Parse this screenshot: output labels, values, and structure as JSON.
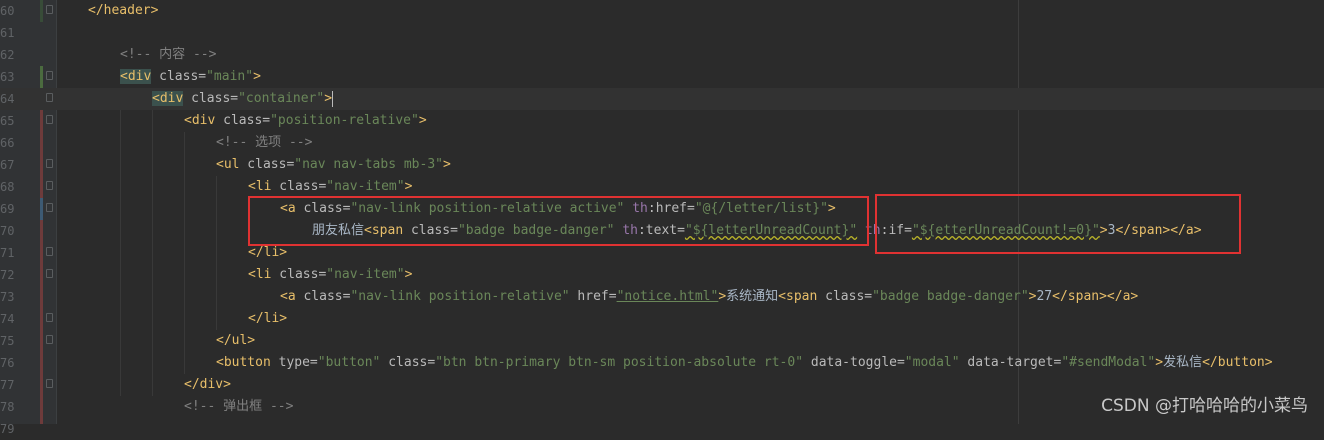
{
  "editor": {
    "lines": [
      {
        "num": "60",
        "parts": [
          {
            "t": "</header>",
            "c": "tag"
          }
        ]
      },
      {
        "num": "61",
        "parts": []
      },
      {
        "num": "62",
        "parts": [
          {
            "t": "<!-- 内容 -->",
            "c": "comment"
          }
        ]
      },
      {
        "num": "63",
        "parts": [
          {
            "t": "<div",
            "c": "tag matched"
          },
          {
            "t": " class=",
            "c": "attr"
          },
          {
            "t": "\"main\"",
            "c": "str"
          },
          {
            "t": ">",
            "c": "tag"
          }
        ]
      },
      {
        "num": "64",
        "parts": [
          {
            "t": "<div",
            "c": "tag matched"
          },
          {
            "t": " class=",
            "c": "attr"
          },
          {
            "t": "\"container\"",
            "c": "str"
          },
          {
            "t": ">",
            "c": "tag"
          }
        ]
      },
      {
        "num": "65",
        "parts": [
          {
            "t": "<div",
            "c": "tag"
          },
          {
            "t": " class=",
            "c": "attr"
          },
          {
            "t": "\"position-relative\"",
            "c": "str"
          },
          {
            "t": ">",
            "c": "tag"
          }
        ]
      },
      {
        "num": "66",
        "parts": [
          {
            "t": "<!-- 选项 -->",
            "c": "comment"
          }
        ]
      },
      {
        "num": "67",
        "parts": [
          {
            "t": "<ul",
            "c": "tag"
          },
          {
            "t": " class=",
            "c": "attr"
          },
          {
            "t": "\"nav nav-tabs mb-3\"",
            "c": "str"
          },
          {
            "t": ">",
            "c": "tag"
          }
        ]
      },
      {
        "num": "68",
        "parts": [
          {
            "t": "<li",
            "c": "tag"
          },
          {
            "t": " class=",
            "c": "attr"
          },
          {
            "t": "\"nav-item\"",
            "c": "str"
          },
          {
            "t": ">",
            "c": "tag"
          }
        ]
      },
      {
        "num": "69",
        "parts": [
          {
            "t": "<a",
            "c": "tag"
          },
          {
            "t": " class=",
            "c": "attr"
          },
          {
            "t": "\"nav-link position-relative active\"",
            "c": "str"
          },
          {
            "t": " th",
            "c": "th"
          },
          {
            "t": ":href=",
            "c": "attr"
          },
          {
            "t": "\"@{/letter/list}\"",
            "c": "str"
          },
          {
            "t": ">",
            "c": "tag"
          }
        ]
      },
      {
        "num": "70",
        "parts": [
          {
            "t": "朋友私信",
            "c": "text"
          },
          {
            "t": "<span",
            "c": "tag"
          },
          {
            "t": " class=",
            "c": "attr"
          },
          {
            "t": "\"badge badge-danger\"",
            "c": "str"
          },
          {
            "t": " th",
            "c": "th"
          },
          {
            "t": ":text=",
            "c": "attr"
          },
          {
            "t": "\"${letterUnreadCount}\"",
            "c": "str squig"
          },
          {
            "t": " th",
            "c": "th"
          },
          {
            "t": ":if=",
            "c": "attr"
          },
          {
            "t": "\"${etterUnreadCount!=0}\"",
            "c": "str squig"
          },
          {
            "t": ">",
            "c": "tag"
          },
          {
            "t": "3",
            "c": "text"
          },
          {
            "t": "</span></a>",
            "c": "tag"
          }
        ]
      },
      {
        "num": "71",
        "parts": [
          {
            "t": "</li>",
            "c": "tag"
          }
        ]
      },
      {
        "num": "72",
        "parts": [
          {
            "t": "<li",
            "c": "tag"
          },
          {
            "t": " class=",
            "c": "attr"
          },
          {
            "t": "\"nav-item\"",
            "c": "str"
          },
          {
            "t": ">",
            "c": "tag"
          }
        ]
      },
      {
        "num": "73",
        "parts": [
          {
            "t": "<a",
            "c": "tag"
          },
          {
            "t": " class=",
            "c": "attr"
          },
          {
            "t": "\"nav-link position-relative\"",
            "c": "str"
          },
          {
            "t": " href=",
            "c": "attr"
          },
          {
            "t": "\"notice.html\"",
            "c": "link"
          },
          {
            "t": ">",
            "c": "tag"
          },
          {
            "t": "系统通知",
            "c": "text"
          },
          {
            "t": "<span",
            "c": "tag"
          },
          {
            "t": " class=",
            "c": "attr"
          },
          {
            "t": "\"badge badge-danger\"",
            "c": "str"
          },
          {
            "t": ">",
            "c": "tag"
          },
          {
            "t": "27",
            "c": "text"
          },
          {
            "t": "</span></a>",
            "c": "tag"
          }
        ]
      },
      {
        "num": "74",
        "parts": [
          {
            "t": "</li>",
            "c": "tag"
          }
        ]
      },
      {
        "num": "75",
        "parts": [
          {
            "t": "</ul>",
            "c": "tag"
          }
        ]
      },
      {
        "num": "76",
        "parts": [
          {
            "t": "<button",
            "c": "tag"
          },
          {
            "t": " type=",
            "c": "attr"
          },
          {
            "t": "\"button\"",
            "c": "str"
          },
          {
            "t": " class=",
            "c": "attr"
          },
          {
            "t": "\"btn btn-primary btn-sm position-absolute rt-0\"",
            "c": "str"
          },
          {
            "t": " data-toggle=",
            "c": "attr"
          },
          {
            "t": "\"modal\"",
            "c": "str"
          },
          {
            "t": " data-target=",
            "c": "attr"
          },
          {
            "t": "\"#sendModal\"",
            "c": "str"
          },
          {
            "t": ">",
            "c": "tag"
          },
          {
            "t": "发私信",
            "c": "text"
          },
          {
            "t": "</button>",
            "c": "tag"
          }
        ]
      },
      {
        "num": "77",
        "parts": [
          {
            "t": "</div>",
            "c": "tag"
          }
        ]
      },
      {
        "num": "78",
        "parts": [
          {
            "t": "<!-- 弹出框 -->",
            "c": "comment"
          }
        ]
      },
      {
        "num": "79",
        "parts": []
      }
    ]
  },
  "watermark": "CSDN @打哈哈哈的小菜鸟"
}
